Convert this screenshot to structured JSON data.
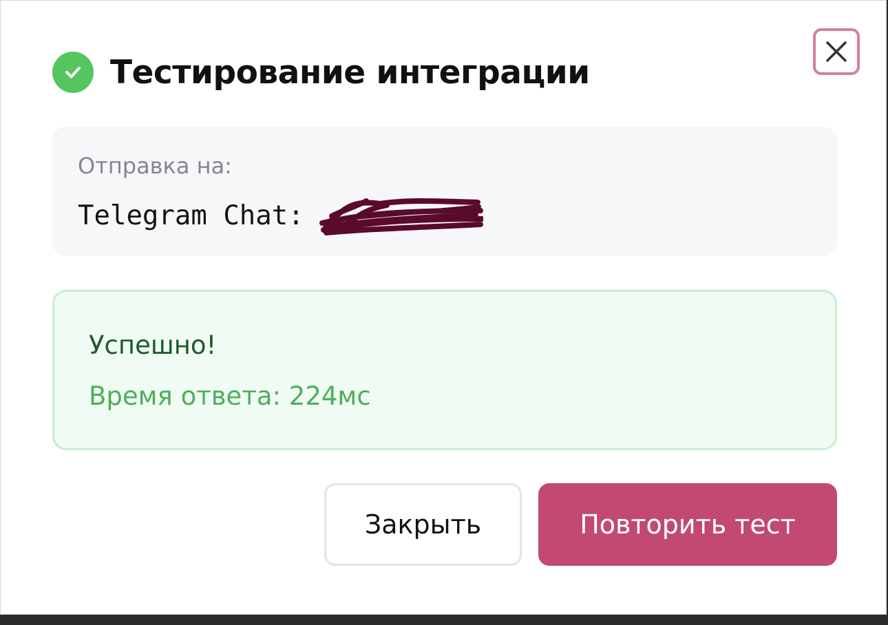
{
  "dialog": {
    "title": "Тестирование интеграции",
    "close_icon": "close-icon",
    "status_icon": "check-circle-icon"
  },
  "destination": {
    "label": "Отправка на:",
    "value": "Telegram Chat:"
  },
  "result": {
    "title": "Успешно!",
    "response_time": "Время ответа: 224мс"
  },
  "actions": {
    "close_label": "Закрыть",
    "retry_label": "Повторить тест"
  },
  "colors": {
    "accent": "#c24a72",
    "success": "#55c55f",
    "success_bg": "#f0fbf3",
    "redaction": "#5a0a2a"
  }
}
